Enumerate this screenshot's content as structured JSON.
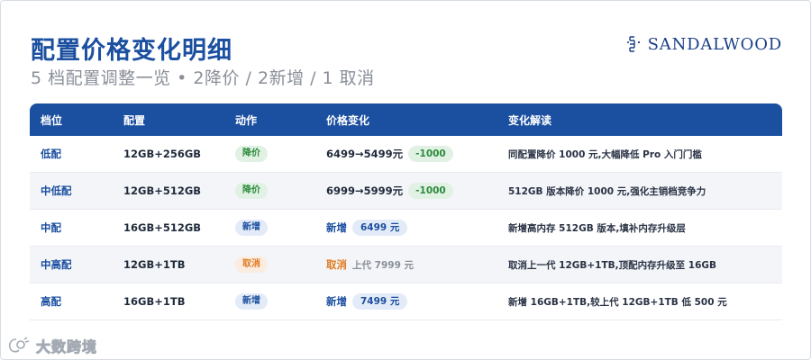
{
  "header": {
    "title": "配置价格变化明细",
    "subtitle": "5 档配置调整一览 • 2降价 / 2新增 / 1 取消",
    "brand": "SANDALWOOD"
  },
  "table": {
    "columns": [
      "档位",
      "配置",
      "动作",
      "价格变化",
      "变化解读"
    ],
    "rows": [
      {
        "tier": "低配",
        "spec": "12GB+256GB",
        "action": "降价",
        "action_type": "down",
        "price": "6499→5499元",
        "delta": "-1000",
        "note": "同配置降价 1000 元,大幅降低 Pro 入门门槛"
      },
      {
        "tier": "中低配",
        "spec": "12GB+512GB",
        "action": "降价",
        "action_type": "down",
        "price": "6999→5999元",
        "delta": "-1000",
        "note": "512GB 版本降价 1000 元,强化主销档竞争力"
      },
      {
        "tier": "中配",
        "spec": "16GB+512GB",
        "action": "新增",
        "action_type": "new",
        "price_label": "新增",
        "new_price": "6499 元",
        "note": "新增高内存 512GB 版本,填补内存升级层"
      },
      {
        "tier": "中高配",
        "spec": "12GB+1TB",
        "action": "取消",
        "action_type": "cancel",
        "price_label": "取消",
        "prev_price": "上代 7999 元",
        "note": "取消上一代 12GB+1TB,顶配内存升级至 16GB"
      },
      {
        "tier": "高配",
        "spec": "16GB+1TB",
        "action": "新增",
        "action_type": "new",
        "price_label": "新增",
        "new_price": "7499 元",
        "note": "新增 16GB+1TB,较上代 12GB+1TB 低 500 元"
      }
    ]
  },
  "watermark": {
    "text": "大数跨境"
  },
  "colors": {
    "accent": "#1b4fa0",
    "down": "#2e8a3d",
    "cancel": "#e07a1f"
  }
}
